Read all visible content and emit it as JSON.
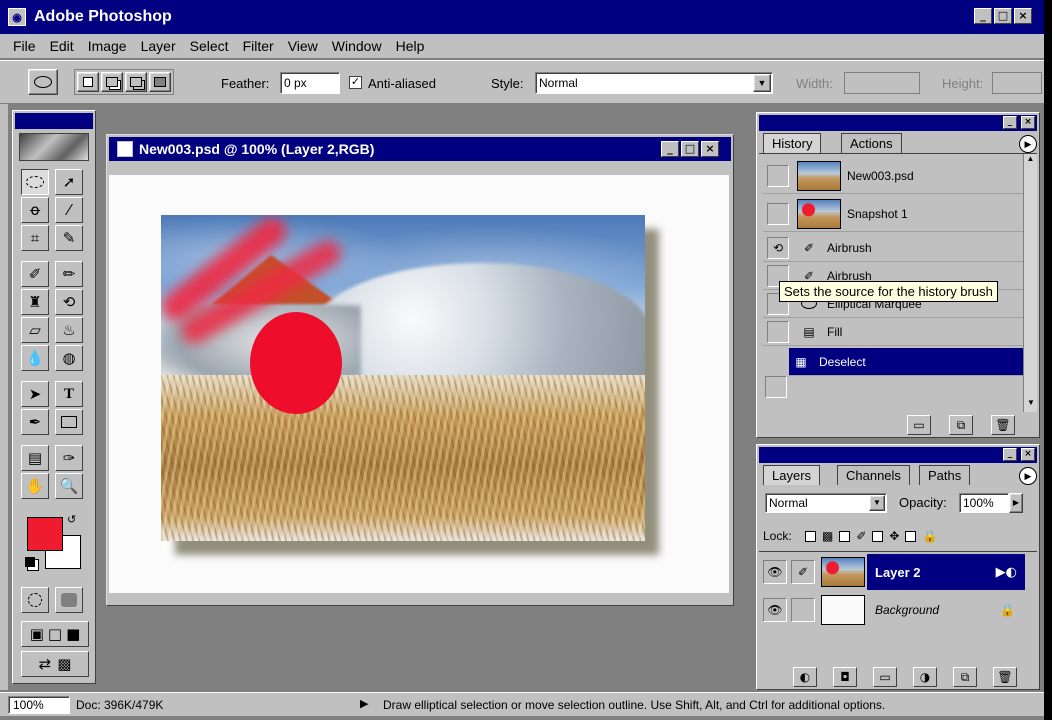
{
  "app": {
    "title": "Adobe Photoshop",
    "icon": "photoshop-eye-icon"
  },
  "menu": [
    "File",
    "Edit",
    "Image",
    "Layer",
    "Select",
    "Filter",
    "View",
    "Window",
    "Help"
  ],
  "options": {
    "feather_label": "Feather:",
    "feather_value": "0 px",
    "antialiased_label": "Anti-aliased",
    "antialiased_checked": true,
    "style_label": "Style:",
    "style_value": "Normal",
    "width_label": "Width:",
    "height_label": "Height:"
  },
  "document": {
    "title": "New003.psd @ 100% (Layer 2,RGB)"
  },
  "history_panel": {
    "tabs": [
      "History",
      "Actions"
    ],
    "items": [
      {
        "label": "New003.psd",
        "type": "snapshot"
      },
      {
        "label": "Snapshot 1",
        "type": "snapshot"
      },
      {
        "label": "Airbrush",
        "icon": "airbrush-icon"
      },
      {
        "label": "Airbrush",
        "icon": "airbrush-icon"
      },
      {
        "label": "Elliptical Marquee",
        "icon": "elliptical-marquee-icon"
      },
      {
        "label": "Fill",
        "icon": "fill-icon"
      },
      {
        "label": "Deselect",
        "icon": "deselect-icon",
        "selected": true
      }
    ],
    "tooltip": "Sets the source for the history brush"
  },
  "layers_panel": {
    "tabs": [
      "Layers",
      "Channels",
      "Paths"
    ],
    "blend_mode": "Normal",
    "opacity_label": "Opacity:",
    "opacity_value": "100%",
    "lock_label": "Lock:",
    "layers": [
      {
        "name": "Layer 2",
        "selected": true
      },
      {
        "name": "Background",
        "locked": true
      }
    ]
  },
  "status": {
    "zoom": "100%",
    "doc": "Doc: 396K/479K",
    "hint": "Draw elliptical selection or move selection outline. Use Shift, Alt, and Ctrl for additional options."
  },
  "colors": {
    "foreground": "#ee1c2e",
    "background": "#ffffff",
    "titlebar": "#000080"
  }
}
